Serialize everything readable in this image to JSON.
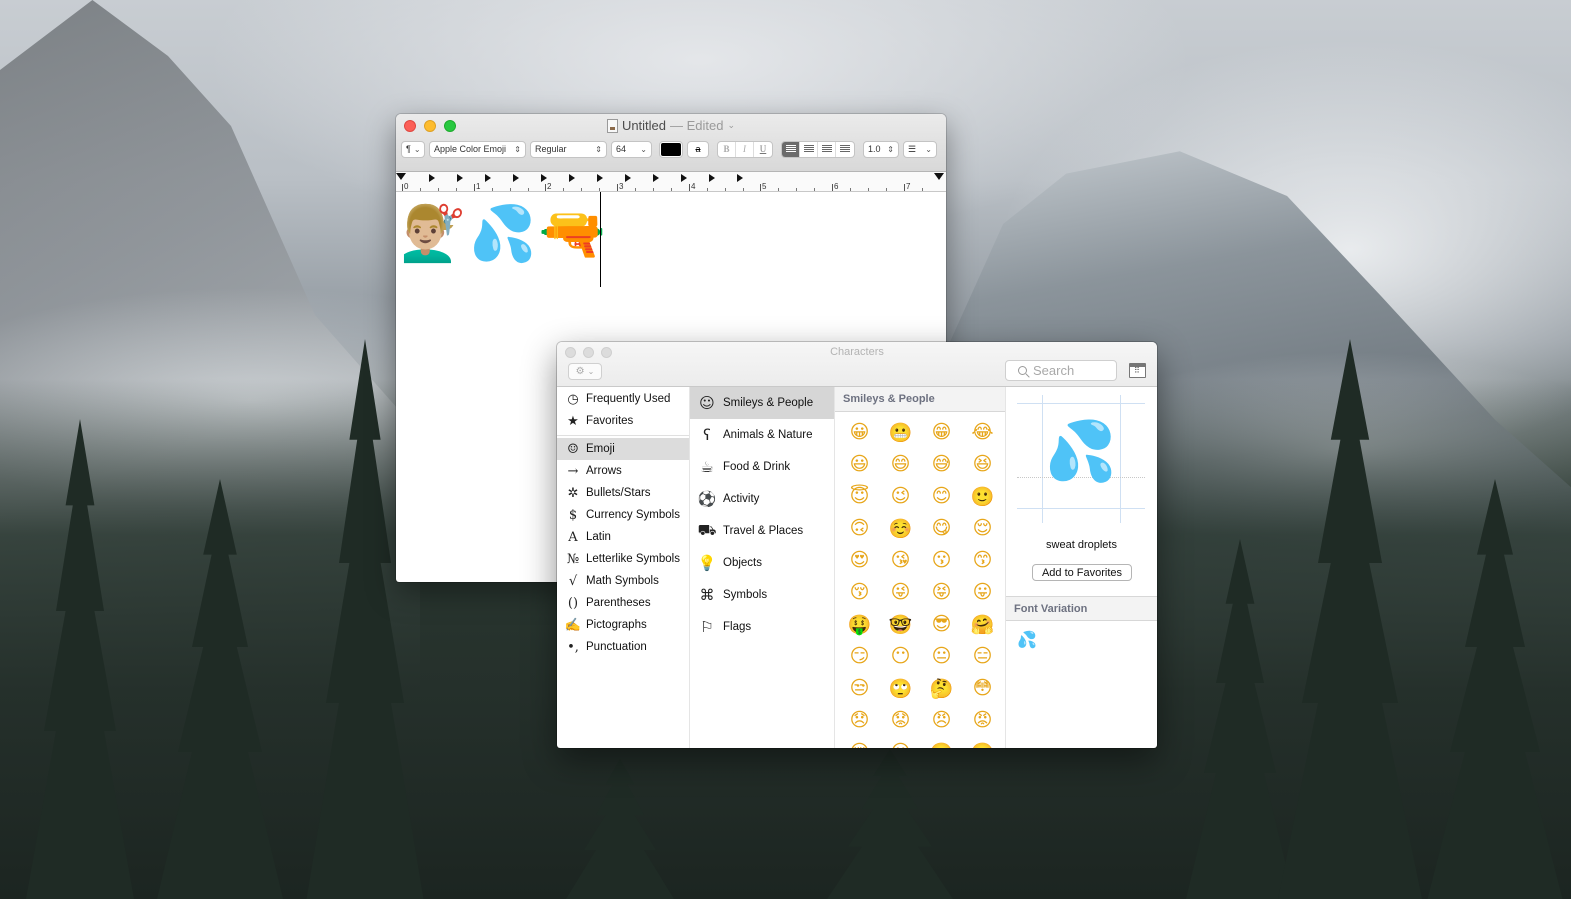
{
  "textedit": {
    "title": "Untitled",
    "edited": "— Edited",
    "toolbar": {
      "paragraph_style": "¶",
      "font_family": "Apple Color Emoji",
      "font_style": "Regular",
      "font_size": "64",
      "bold": "B",
      "italic": "I",
      "underline": "U",
      "line_spacing": "1.0",
      "alignment_selected": "left"
    },
    "ruler_labels": [
      "0",
      "1",
      "2",
      "3",
      "4",
      "5",
      "6",
      "7"
    ],
    "content": "💇🏼‍♂️💦🔫"
  },
  "characters": {
    "title": "Characters",
    "search": {
      "placeholder": "Search",
      "value": ""
    },
    "sidebar": [
      {
        "icon": "clock-icon",
        "glyph": "◷",
        "label": "Frequently Used"
      },
      {
        "icon": "star-icon",
        "glyph": "★",
        "label": "Favorites"
      },
      {
        "icon": "smiley-icon",
        "glyph": "☺",
        "label": "Emoji",
        "selected": true
      },
      {
        "icon": "arrow-icon",
        "glyph": "→",
        "label": "Arrows"
      },
      {
        "icon": "asterisk-icon",
        "glyph": "✲",
        "label": "Bullets/Stars"
      },
      {
        "icon": "dollar-icon",
        "glyph": "$",
        "label": "Currency Symbols"
      },
      {
        "icon": "latin-a-icon",
        "glyph": "A",
        "label": "Latin"
      },
      {
        "icon": "numero-icon",
        "glyph": "№",
        "label": "Letterlike Symbols"
      },
      {
        "icon": "sqrt-icon",
        "glyph": "√",
        "label": "Math Symbols"
      },
      {
        "icon": "parentheses-icon",
        "glyph": "()",
        "label": "Parentheses"
      },
      {
        "icon": "pictograph-icon",
        "glyph": "✍",
        "label": "Pictographs"
      },
      {
        "icon": "punctuation-icon",
        "glyph": "•,",
        "label": "Punctuation"
      }
    ],
    "categories": [
      {
        "icon": "smiley-icon",
        "glyph": "☺",
        "label": "Smileys & People",
        "selected": true
      },
      {
        "icon": "bear-icon",
        "glyph": "ʕ",
        "label": "Animals & Nature"
      },
      {
        "icon": "food-icon",
        "glyph": "☕",
        "label": "Food & Drink"
      },
      {
        "icon": "soccer-ball-icon",
        "glyph": "⚽",
        "label": "Activity"
      },
      {
        "icon": "building-car-icon",
        "glyph": "⛟",
        "label": "Travel & Places"
      },
      {
        "icon": "lightbulb-icon",
        "glyph": "💡",
        "label": "Objects"
      },
      {
        "icon": "symbols-icon",
        "glyph": "⌘",
        "label": "Symbols"
      },
      {
        "icon": "flag-icon",
        "glyph": "⚐",
        "label": "Flags"
      }
    ],
    "section_title": "Smileys & People",
    "emojis": [
      "😀",
      "😬",
      "😁",
      "😂",
      "😃",
      "😄",
      "😅",
      "😆",
      "😇",
      "😉",
      "😊",
      "🙂",
      "🙃",
      "☺️",
      "😋",
      "😌",
      "😍",
      "😘",
      "😗",
      "😙",
      "😚",
      "😜",
      "😝",
      "😛",
      "🤑",
      "🤓",
      "😎",
      "🤗",
      "😏",
      "😶",
      "😐",
      "😑",
      "😒",
      "🙄",
      "🤔",
      "😳",
      "😞",
      "😟",
      "😠",
      "😡",
      "😔",
      "😕",
      "🙁",
      "☹️"
    ],
    "preview": {
      "glyph": "💦",
      "name": "sweat droplets",
      "add_favorites_label": "Add to Favorites",
      "font_variation_label": "Font Variation",
      "variations": [
        "💦"
      ]
    }
  }
}
